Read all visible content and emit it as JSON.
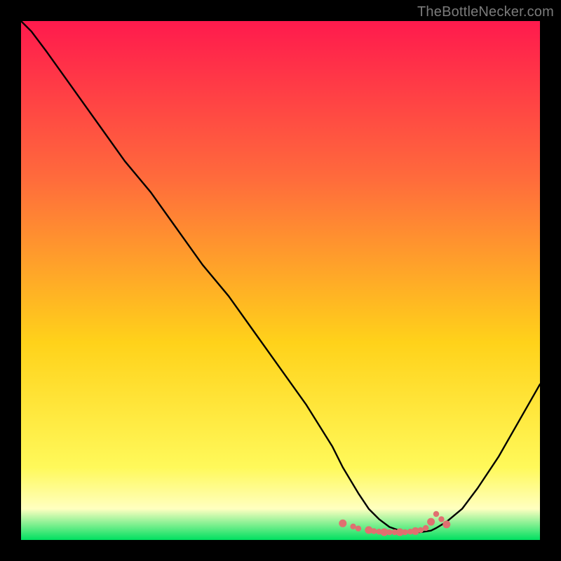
{
  "attribution": "TheBottleNecker.com",
  "colors": {
    "frame": "#000000",
    "grad_top": "#ff1a4d",
    "grad_mid_upper": "#ff6a3c",
    "grad_mid": "#ffd21a",
    "grad_lower": "#fff95a",
    "grad_bottom_band": "#ffffc0",
    "grad_green": "#00e060",
    "curve": "#000000",
    "dots": "#e07070"
  },
  "chart_data": {
    "type": "line",
    "title": "",
    "xlabel": "",
    "ylabel": "",
    "xlim": [
      0,
      100
    ],
    "ylim": [
      0,
      100
    ],
    "x": [
      0,
      2,
      5,
      10,
      15,
      20,
      25,
      30,
      35,
      40,
      45,
      50,
      55,
      60,
      62,
      65,
      67,
      69,
      71,
      73,
      75,
      77,
      79,
      80,
      82,
      85,
      88,
      92,
      96,
      100
    ],
    "values": [
      100,
      98,
      94,
      87,
      80,
      73,
      67,
      60,
      53,
      47,
      40,
      33,
      26,
      18,
      14,
      9,
      6,
      4,
      2.5,
      1.8,
      1.5,
      1.5,
      1.8,
      2.3,
      3.5,
      6,
      10,
      16,
      23,
      30
    ],
    "dot_cluster": {
      "x": [
        62,
        64,
        65,
        67,
        68,
        69,
        70,
        71,
        72,
        73,
        74,
        75,
        76,
        77,
        78,
        79,
        80,
        81,
        82
      ],
      "y": [
        3.2,
        2.6,
        2.2,
        1.9,
        1.7,
        1.6,
        1.5,
        1.5,
        1.5,
        1.5,
        1.5,
        1.6,
        1.7,
        1.9,
        2.3,
        3.5,
        5.0,
        4.0,
        3.0
      ]
    }
  }
}
